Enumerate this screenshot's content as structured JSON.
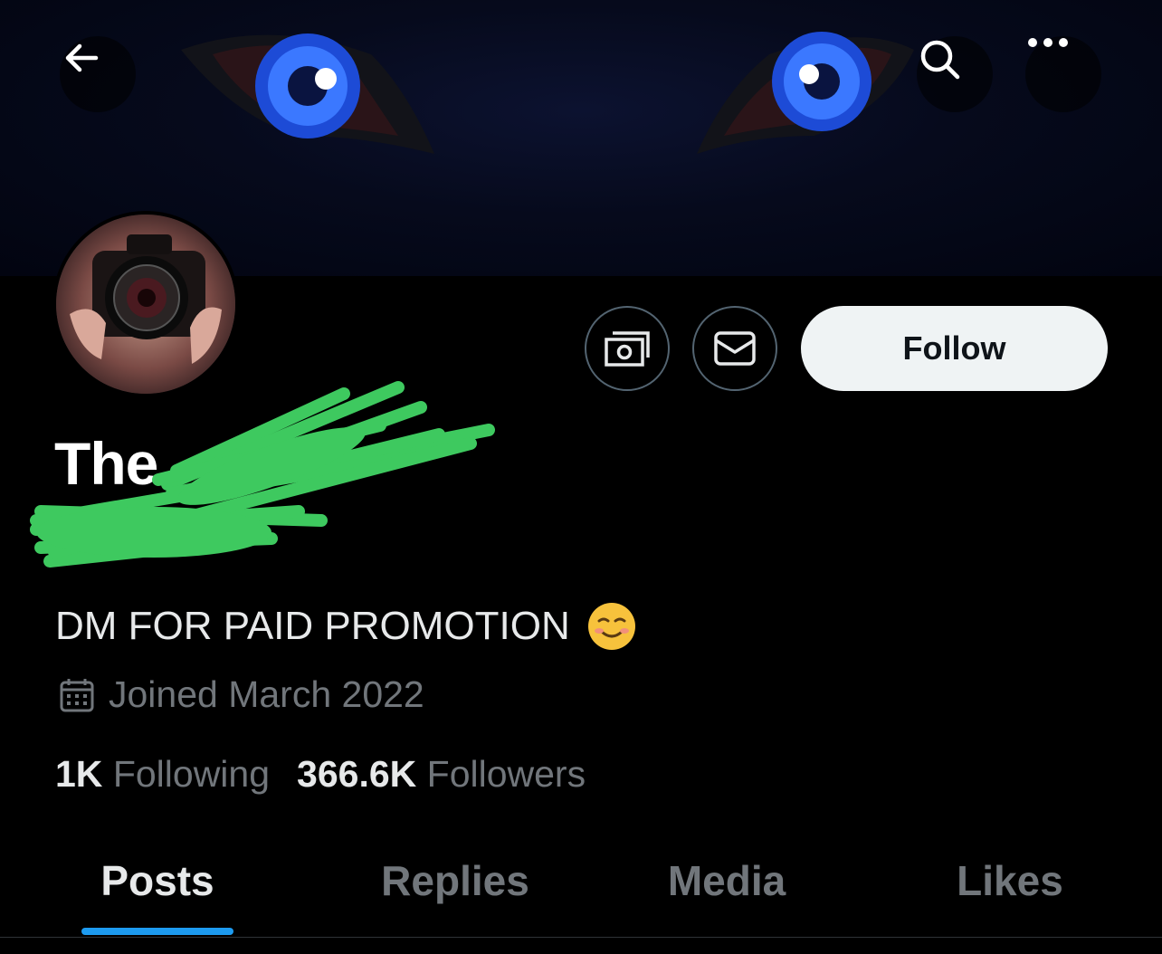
{
  "profile": {
    "display_name": "The",
    "bio": "DM FOR PAID PROMOTION",
    "joined": "Joined March 2022",
    "following_count": "1K",
    "following_label": "Following",
    "followers_count": "366.6K",
    "followers_label": "Followers"
  },
  "actions": {
    "follow_label": "Follow"
  },
  "tabs": [
    {
      "label": "Posts",
      "active": true
    },
    {
      "label": "Replies",
      "active": false
    },
    {
      "label": "Media",
      "active": false
    },
    {
      "label": "Likes",
      "active": false
    }
  ],
  "icons": {
    "back": "arrow-left-icon",
    "search": "search-icon",
    "more": "more-icon",
    "subscribe": "money-icon",
    "message": "envelope-icon",
    "calendar": "calendar-icon",
    "bio_emoji": "smiling-face-emoji"
  },
  "colors": {
    "background": "#000000",
    "accent": "#1d9bf0",
    "muted_text": "#71767b",
    "redaction": "#3ec95f",
    "eye": "#2f6cf0"
  }
}
